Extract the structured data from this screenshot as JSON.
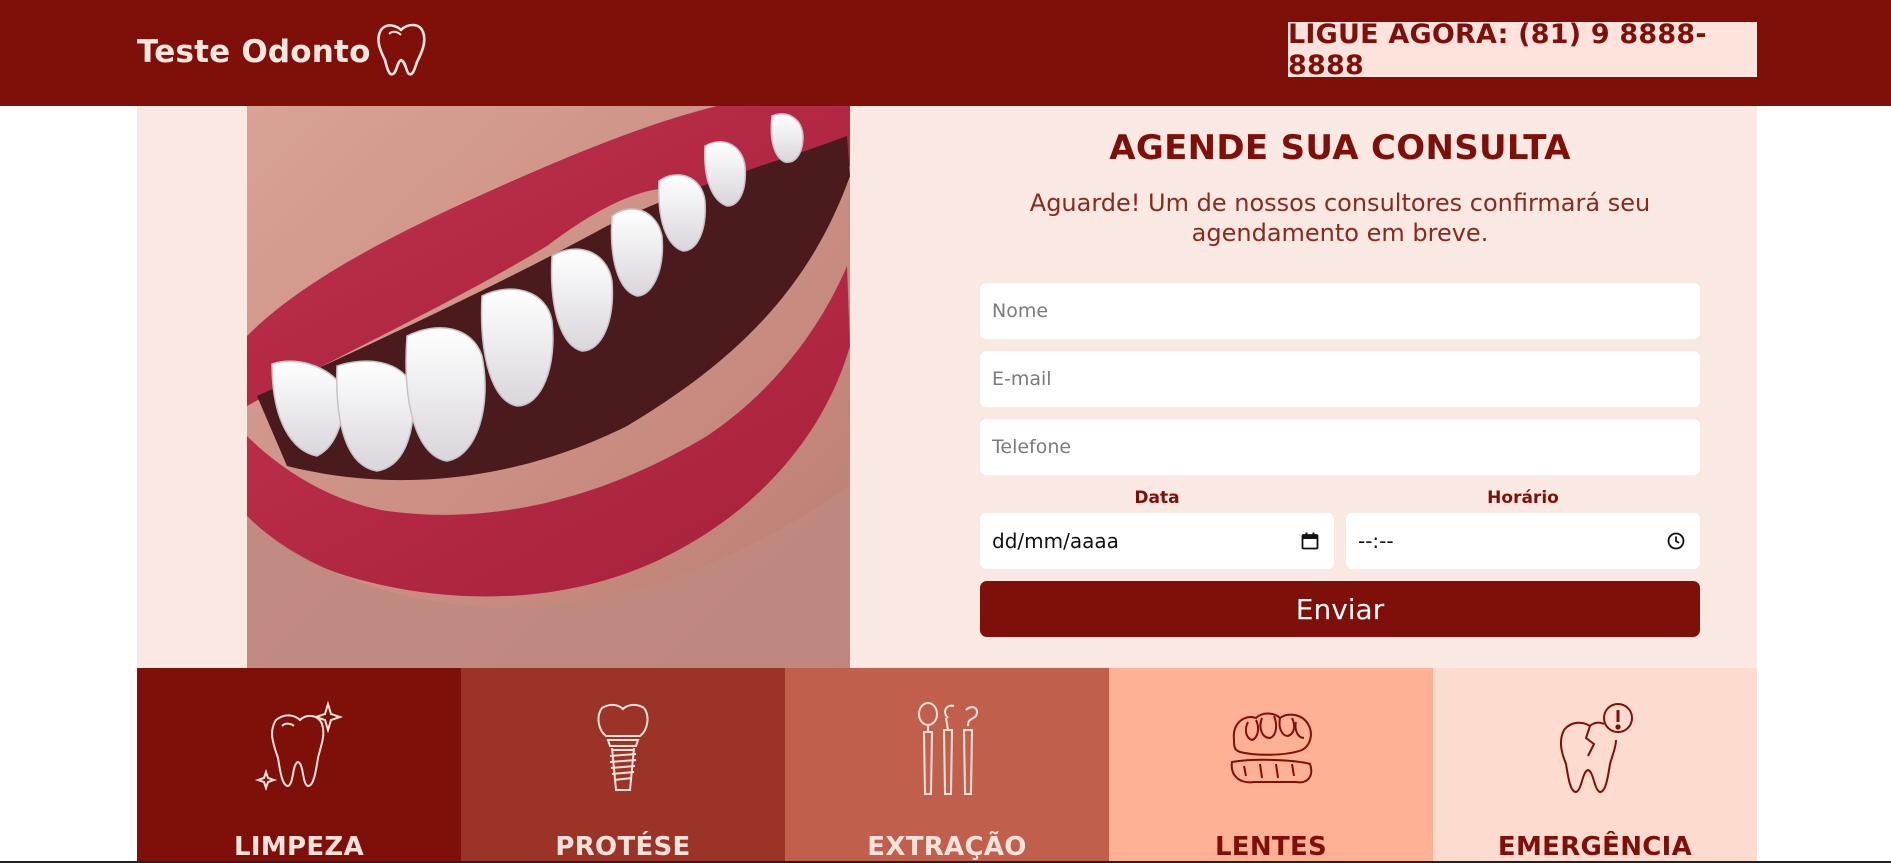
{
  "header": {
    "logo_text": "Teste Odonto",
    "cta_label": "LIGUE AGORA: (81) 9 8888-8888"
  },
  "form": {
    "title": "AGENDE SUA CONSULTA",
    "subtitle": "Aguarde! Um de nossos consultores confirmará seu agendamento em breve.",
    "name_placeholder": "Nome",
    "email_placeholder": "E-mail",
    "phone_placeholder": "Telefone",
    "date_label": "Data",
    "date_value": "dd/mm/aaaa",
    "time_label": "Horário",
    "time_value": "--:--",
    "submit_label": "Enviar"
  },
  "services": [
    {
      "label": "LIMPEZA",
      "icon": "tooth-sparkle-icon",
      "bg": "#7e0f09",
      "fg": "#fbe3dc"
    },
    {
      "label": "PROTÉSE",
      "icon": "dental-implant-icon",
      "bg": "#9b3326",
      "fg": "#fbe3dc"
    },
    {
      "label": "EXTRAÇÃO",
      "icon": "dental-tools-icon",
      "bg": "#bf5f4c",
      "fg": "#fbe3dc"
    },
    {
      "label": "LENTES",
      "icon": "dentures-icon",
      "bg": "#ffb196",
      "fg": "#7e0f09"
    },
    {
      "label": "EMERGÊNCIA",
      "icon": "broken-tooth-alert-icon",
      "bg": "#fedbcf",
      "fg": "#7e0f09"
    }
  ],
  "colors": {
    "brand": "#7e0f09",
    "panel": "#fae8e3",
    "cta_bg": "#fde3dc"
  }
}
